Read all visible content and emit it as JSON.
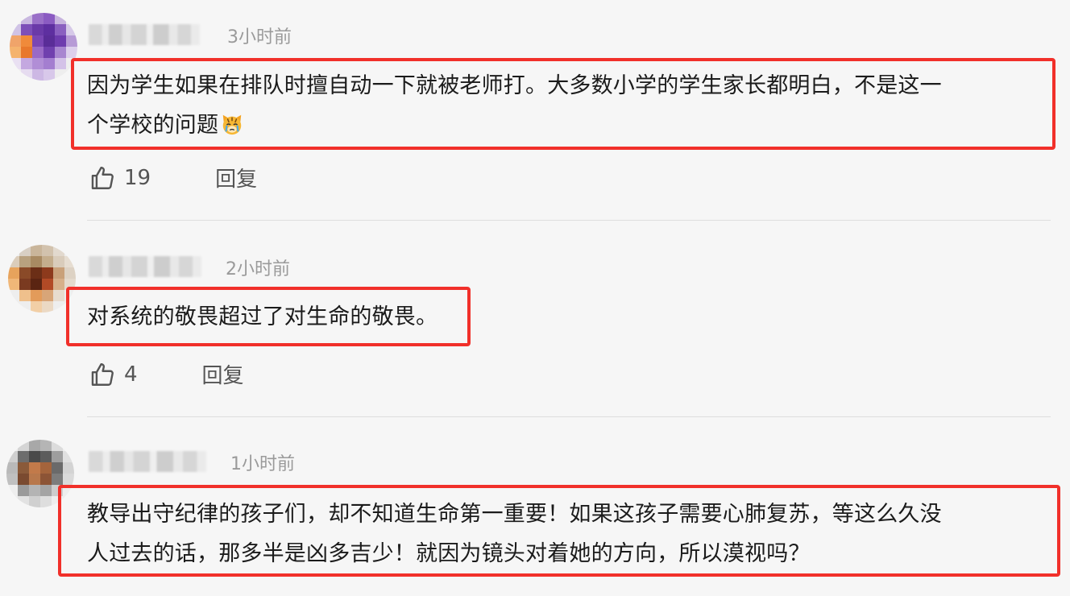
{
  "comments": [
    {
      "time": "3小时前",
      "text_line1": "因为学生如果在排队时擅自动一下就被老师打。大多数小学的学生家长都明白，不是这一",
      "text_line2": "个学校的问题",
      "emoji": "tiger-crying-emoji",
      "likes": "19",
      "reply": "回复"
    },
    {
      "time": "2小时前",
      "text_line1": "对系统的敬畏超过了对生命的敬畏。",
      "likes": "4",
      "reply": "回复"
    },
    {
      "time": "1小时前",
      "text_line1": "教导出守纪律的孩子们，却不知道生命第一重要！如果这孩子需要心肺复苏，等这么久没",
      "text_line2": "人过去的话，那多半是凶多吉少！就因为镜头对着她的方向，所以漠视吗？"
    }
  ],
  "colors": {
    "highlight": "#f1302a",
    "muted": "#9a9a9a",
    "background": "#f6f6f6"
  }
}
